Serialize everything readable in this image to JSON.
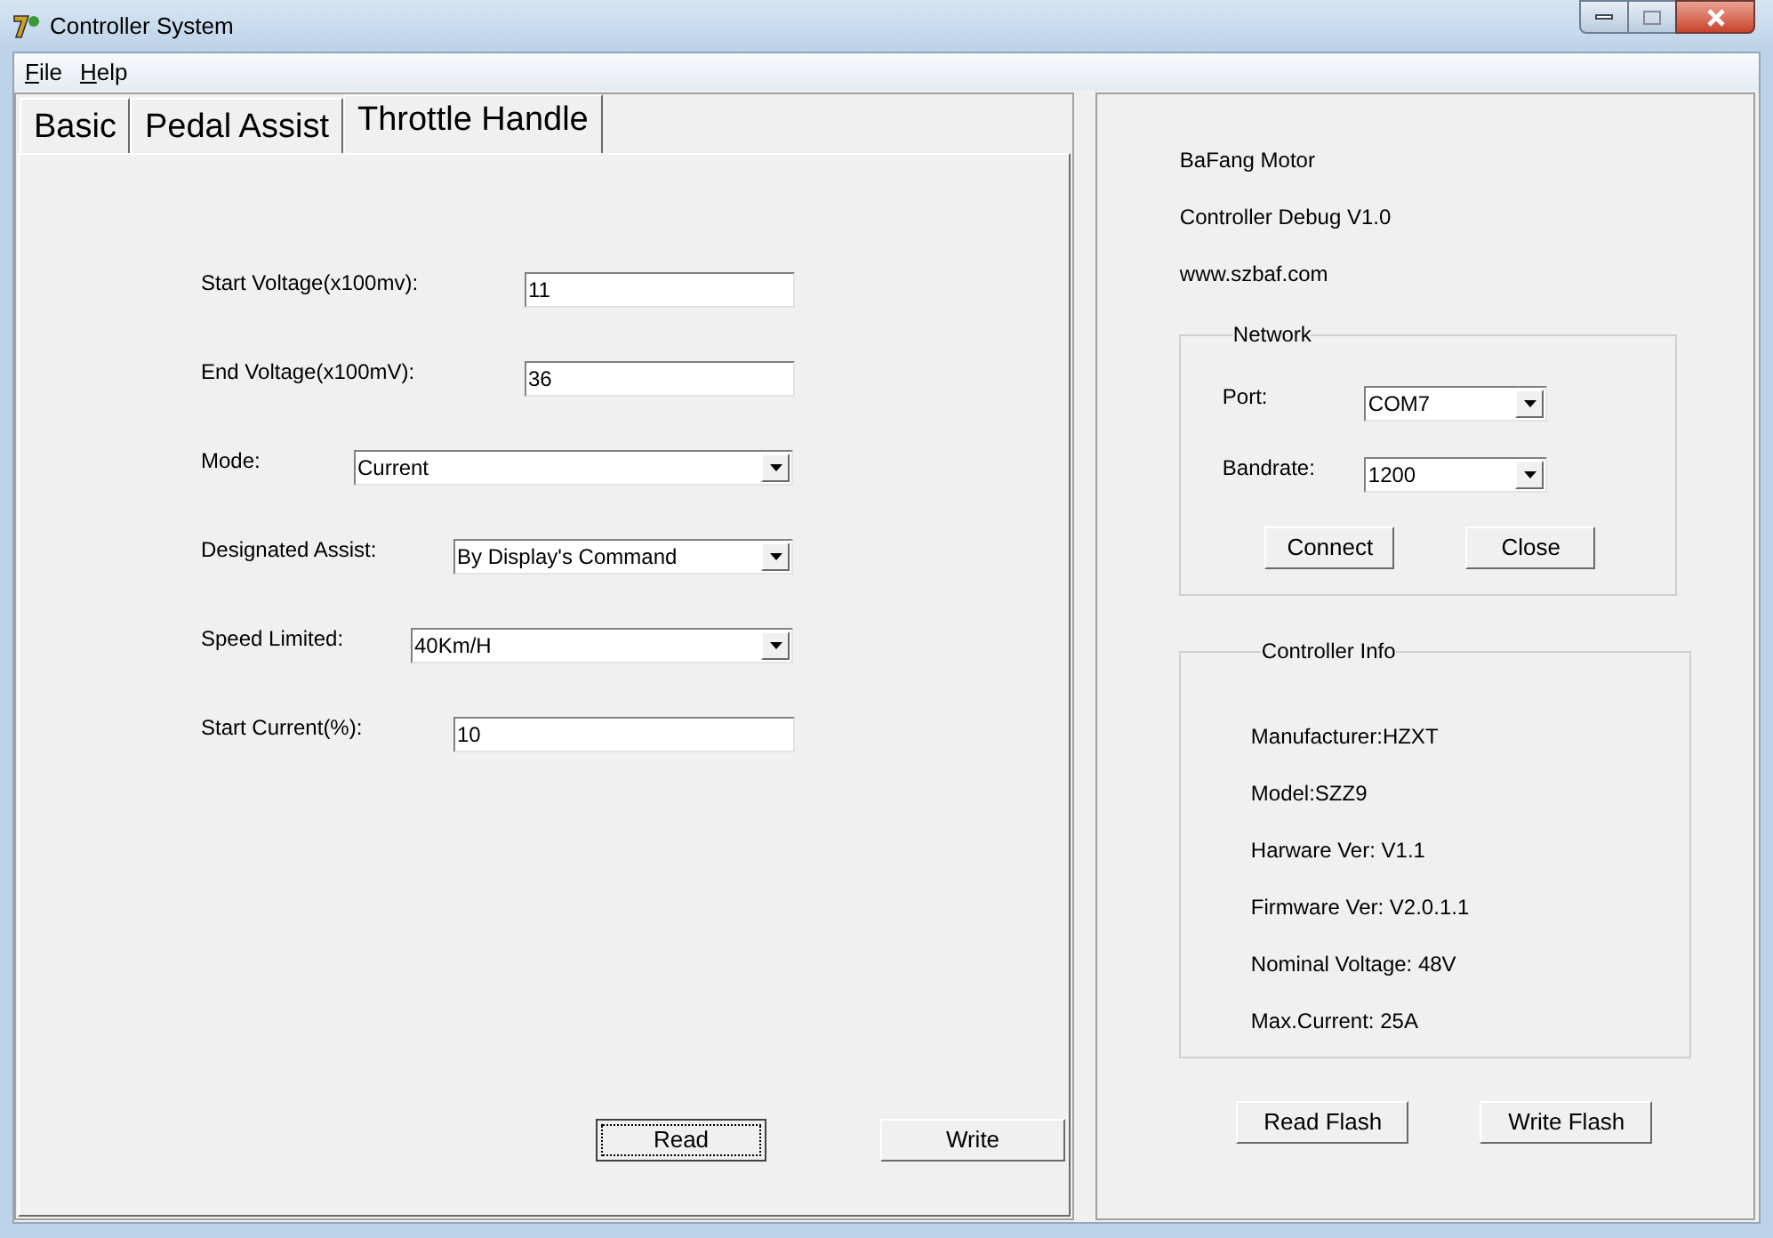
{
  "window": {
    "title": "Controller System"
  },
  "menu": [
    {
      "label": "File"
    },
    {
      "label": "Help"
    }
  ],
  "tabs": [
    {
      "label": "Basic",
      "selected": false
    },
    {
      "label": "Pedal Assist",
      "selected": false
    },
    {
      "label": "Throttle Handle",
      "selected": true
    }
  ],
  "form": [
    {
      "kind": "text",
      "label": "Start Voltage(x100mv):",
      "value": "11"
    },
    {
      "kind": "text",
      "label": "End Voltage(x100mV):",
      "value": "36"
    },
    {
      "kind": "dropdown",
      "label": "Mode:",
      "value": "Current"
    },
    {
      "kind": "dropdown",
      "label": "Designated Assist:",
      "value": "By Display's Command"
    },
    {
      "kind": "dropdown",
      "label": "Speed Limited:",
      "value": "40Km/H"
    },
    {
      "kind": "text",
      "label": "Start Current(%):",
      "value": "10"
    }
  ],
  "form_buttons": [
    {
      "label": "Read",
      "focused": true
    },
    {
      "label": "Write",
      "focused": false
    }
  ],
  "about": [
    "BaFang Motor",
    "Controller Debug V1.0",
    "www.szbaf.com"
  ],
  "network": {
    "title": "Network",
    "fields": [
      {
        "label": "Port:",
        "value": "COM7"
      },
      {
        "label": "Bandrate:",
        "value": "1200"
      }
    ],
    "buttons": [
      "Connect",
      "Close"
    ]
  },
  "controller_info": {
    "title": "Controller Info",
    "items": [
      "Manufacturer:HZXT",
      "Model:SZZ9",
      "Harware Ver: V1.1",
      "Firmware Ver: V2.0.1.1",
      "Nominal Voltage: 48V",
      "Max.Current: 25A"
    ]
  },
  "flash_buttons": [
    "Read Flash",
    "Write Flash"
  ]
}
